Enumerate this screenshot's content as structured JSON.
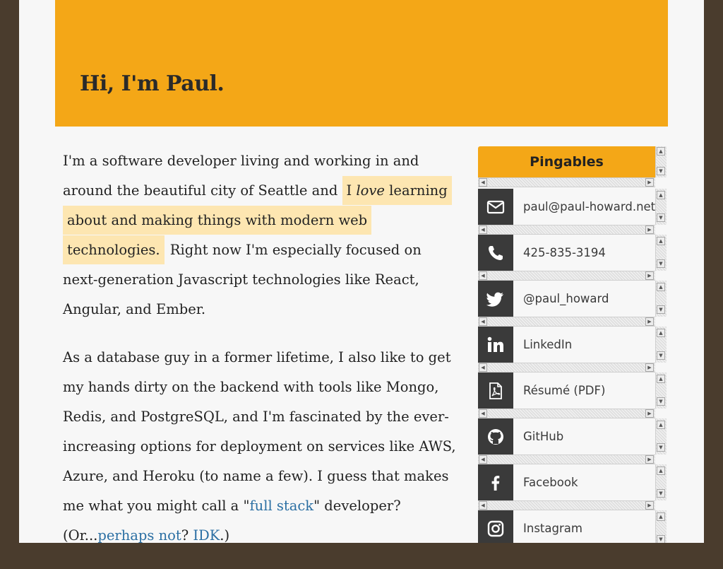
{
  "header": {
    "title": "Hi, I'm Paul."
  },
  "intro": {
    "p1_a": "I'm a software developer living and working in and around the beautiful city of Seattle and ",
    "p1_hl_a": "I ",
    "p1_hl_em": "love",
    "p1_hl_b": " learning about and making things with modern web technologies.",
    "p1_b": " Right now I'm especially focused on next-generation Javascript technologies like React, Angular, and Ember.",
    "p2_a": "As a database guy in a former lifetime, I also like to get my hands dirty on the backend with tools like Mongo, Redis, and PostgreSQL, and I'm fascinated by the ever-increasing options for deployment on services like AWS, Azure, and Heroku (to name a few). I guess that makes me what you might call a \"",
    "link_full_stack": "full stack",
    "p2_b": "\" developer? (Or...",
    "link_perhaps_not": "perhaps not",
    "p2_c": "? ",
    "link_idk": "IDK",
    "p2_d": ".)"
  },
  "sidebar": {
    "title": "Pingables",
    "scroll_up": "▲",
    "scroll_down": "▼",
    "scroll_left": "◀",
    "scroll_right": "▶",
    "items": [
      {
        "label": "paul@paul-howard.net",
        "icon": "envelope-icon"
      },
      {
        "label": "425-835-3194",
        "icon": "phone-icon"
      },
      {
        "label": "@paul_howard",
        "icon": "twitter-icon"
      },
      {
        "label": "LinkedIn",
        "icon": "linkedin-icon"
      },
      {
        "label": "Résumé (PDF)",
        "icon": "pdf-file-icon"
      },
      {
        "label": "GitHub",
        "icon": "github-icon"
      },
      {
        "label": "Facebook",
        "icon": "facebook-icon"
      },
      {
        "label": "Instagram",
        "icon": "instagram-icon"
      }
    ]
  },
  "colors": {
    "accent": "#f4a717",
    "highlight": "#fde6b1",
    "icon_bg": "#3a3a3a",
    "link": "#2b6fa3"
  }
}
